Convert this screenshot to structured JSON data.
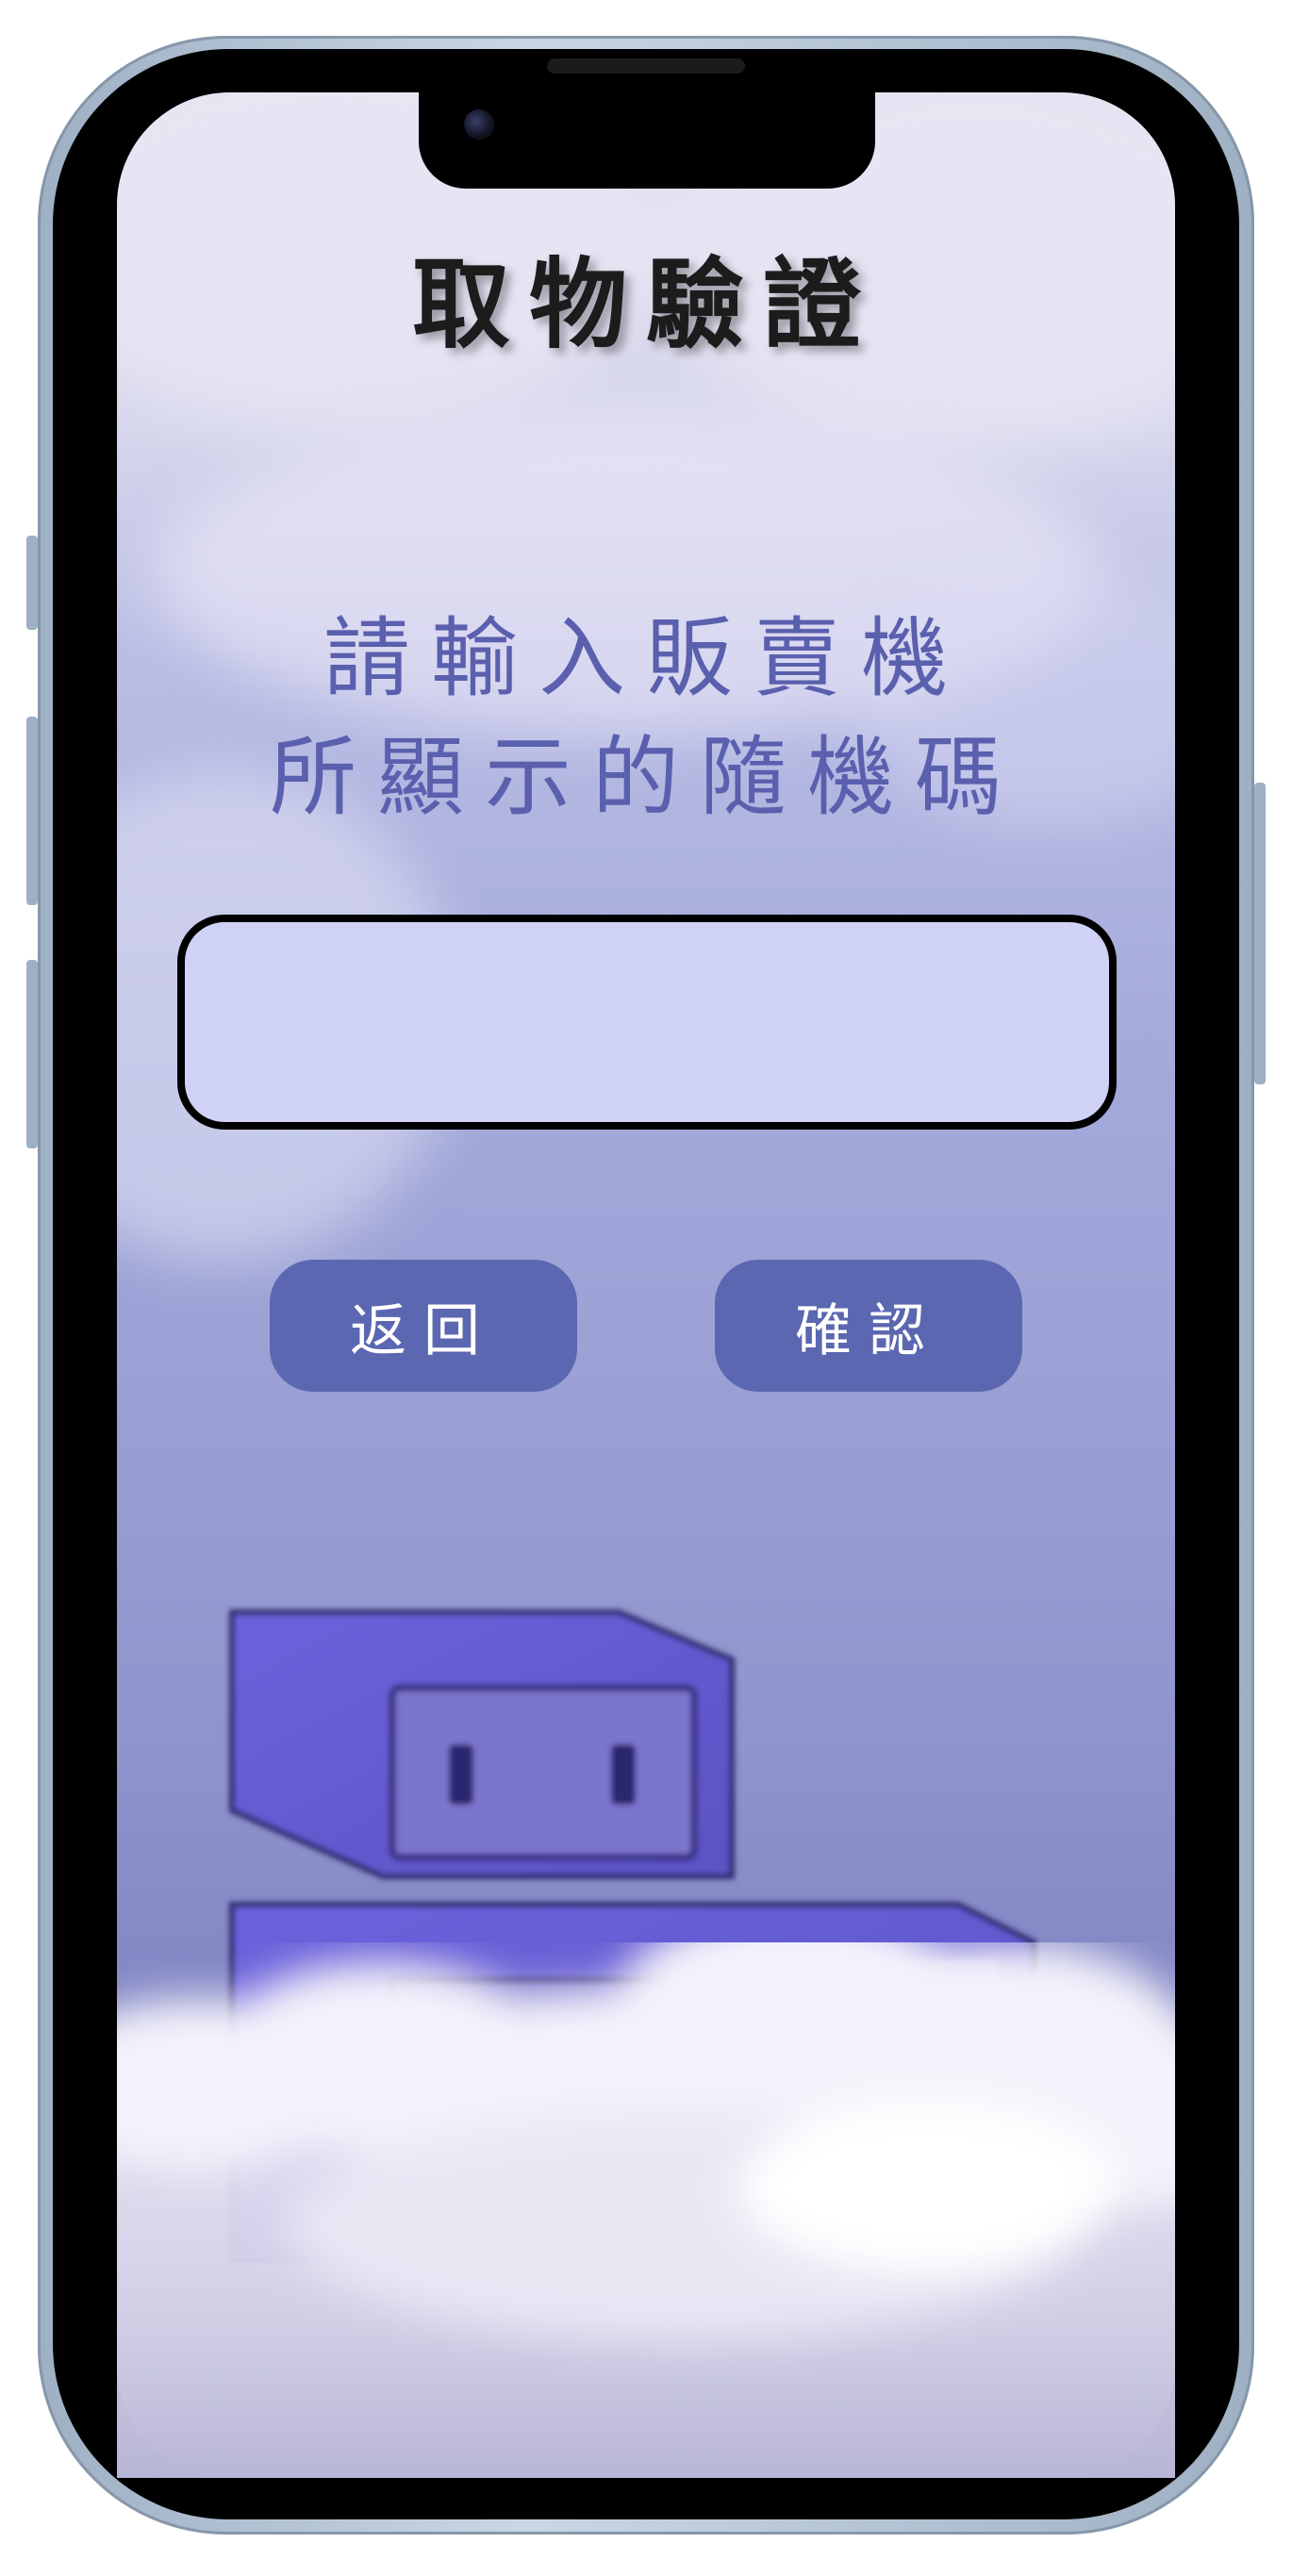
{
  "header": {
    "title": "取物驗證"
  },
  "instruction": {
    "line1": "請輸入販賣機",
    "line2": "所顯示的隨機碼"
  },
  "code_input": {
    "value": "",
    "placeholder": ""
  },
  "buttons": {
    "back_label": "返回",
    "confirm_label": "確認"
  },
  "colors": {
    "button_bg": "#5b67b0",
    "input_bg": "#cfd2f4",
    "instruction_text": "#5a60ae",
    "robot_body": "#6a63d8"
  },
  "decor": {
    "mascot": "robot-mascot",
    "clouds": "cloud-fog"
  }
}
